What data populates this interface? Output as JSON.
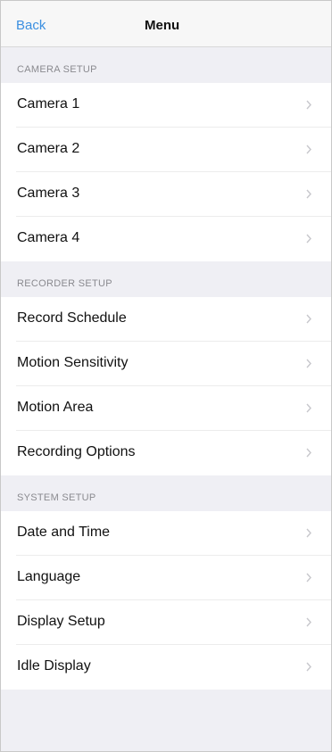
{
  "nav": {
    "back_label": "Back",
    "title": "Menu"
  },
  "sections": [
    {
      "header": "CAMERA SETUP",
      "items": [
        "Camera 1",
        "Camera 2",
        "Camera 3",
        "Camera 4"
      ]
    },
    {
      "header": "RECORDER SETUP",
      "items": [
        "Record Schedule",
        "Motion Sensitivity",
        "Motion Area",
        "Recording Options"
      ]
    },
    {
      "header": "SYSTEM SETUP",
      "items": [
        "Date and Time",
        "Language",
        "Display Setup",
        "Idle Display"
      ]
    }
  ],
  "icons": {
    "row_chevron": "chevron-right-icon"
  },
  "colors": {
    "accent": "#3b8fe0",
    "group_background": "#efeff4",
    "section_header_text": "#8a8a8f",
    "chevron": "#c7c7cc"
  }
}
